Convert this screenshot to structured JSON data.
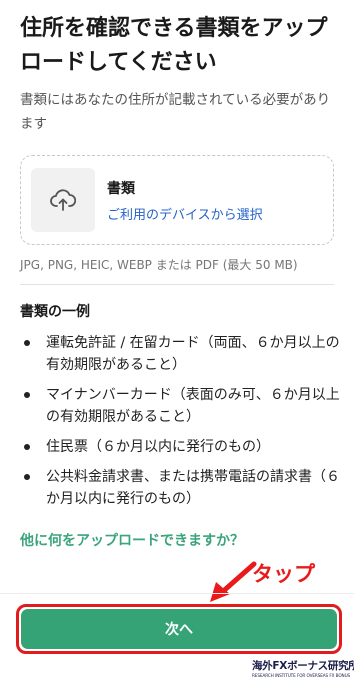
{
  "header": {
    "title": "住所を確認できる書類をアップロードしてください",
    "subtitle": "書類にはあなたの住所が記載されている必要があります"
  },
  "upload": {
    "icon": "cloud-upload-icon",
    "label": "書類",
    "link": "ご利用のデバイスから選択",
    "formats": "JPG, PNG, HEIC, WEBP または PDF (最大 50 MB)"
  },
  "examples": {
    "title": "書類の一例",
    "items": [
      "運転免許証 / 在留カード（両面、６か月以上の有効期限があること）",
      "マイナンバーカード（表面のみ可、６か月以上の有効期限があること）",
      "住民票（６か月以内に発行のもの）",
      "公共料金請求書、または携帯電話の請求書（６か月以内に発行のもの）"
    ]
  },
  "more_link": "他に何をアップロードできますか？",
  "annotation": "タップ",
  "next_button": "次へ",
  "watermark": {
    "main": "海外FXボーナス研究所",
    "sub": "RESEARCH INSTITUTE FOR OVERSEAS FX BONUS"
  },
  "colors": {
    "accent_green": "#36a377",
    "link_blue": "#2563c9",
    "annotation_red": "#e81a1a"
  }
}
